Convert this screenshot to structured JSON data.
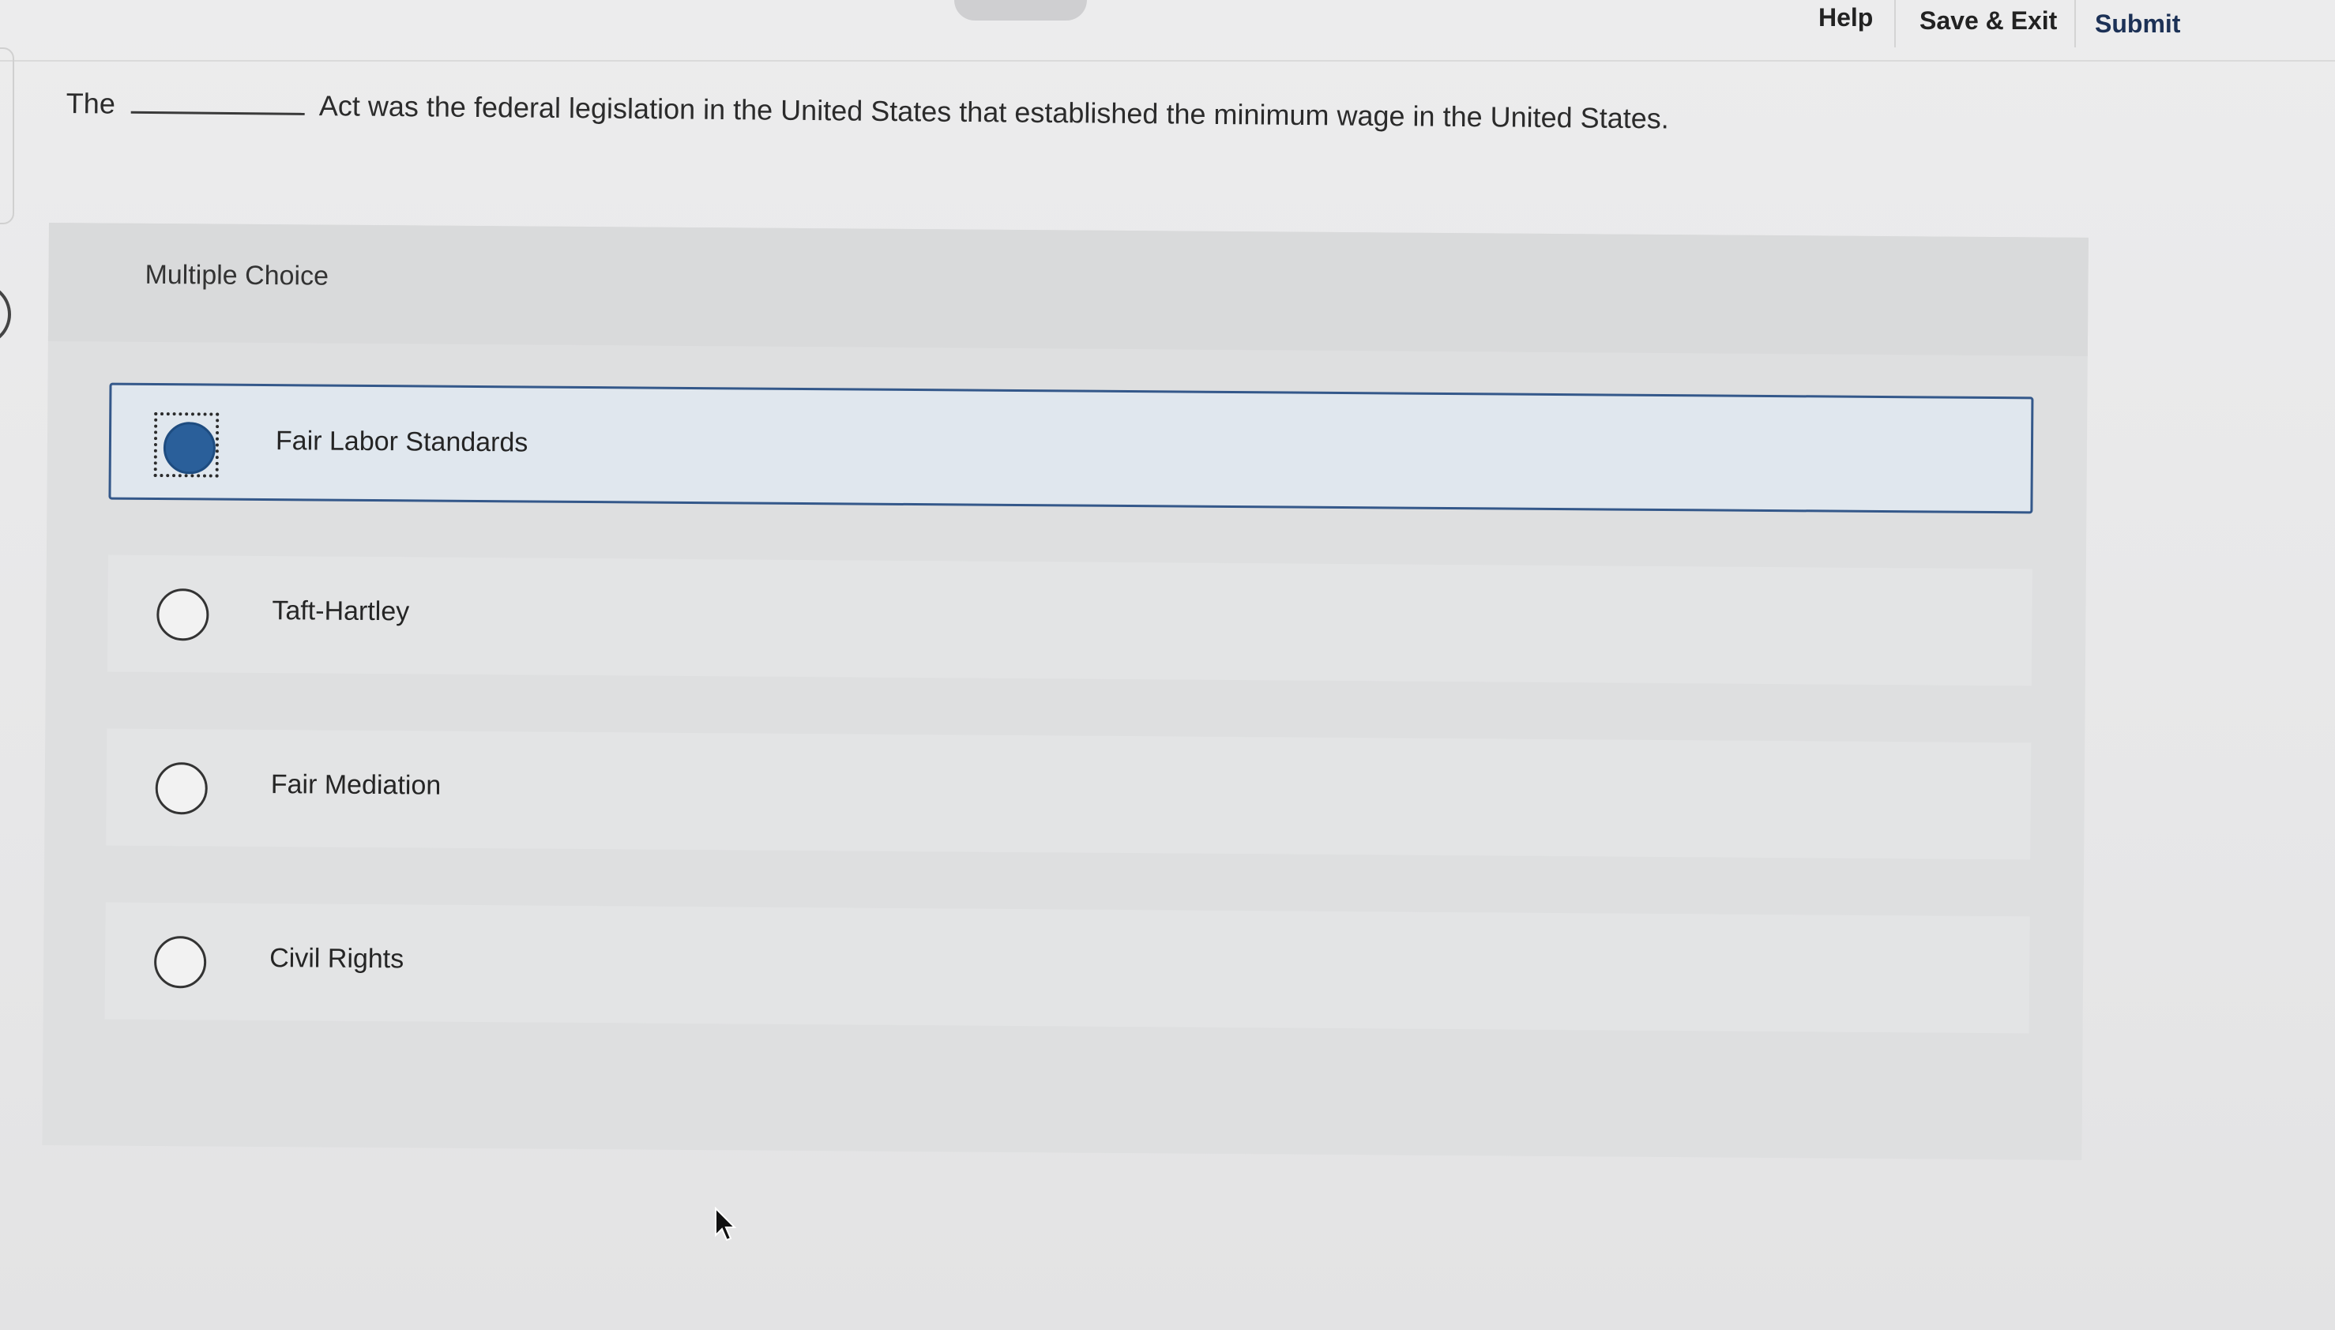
{
  "topbar": {
    "help_label": "Help",
    "save_exit_label": "Save & Exit",
    "submit_label": "Submit"
  },
  "question": {
    "prefix": "The",
    "suffix": "Act was the federal legislation in the United States that established the minimum wage in the United States."
  },
  "multiple_choice": {
    "title": "Multiple Choice",
    "options": [
      {
        "label": "Fair Labor Standards",
        "selected": true
      },
      {
        "label": "Taft-Hartley",
        "selected": false
      },
      {
        "label": "Fair Mediation",
        "selected": false
      },
      {
        "label": "Civil Rights",
        "selected": false
      }
    ]
  },
  "colors": {
    "accent": "#2a5f9a",
    "selected_border": "#34588a",
    "selected_bg": "#e0e7ee"
  },
  "icons": {
    "cursor": "mouse-pointer-icon"
  }
}
